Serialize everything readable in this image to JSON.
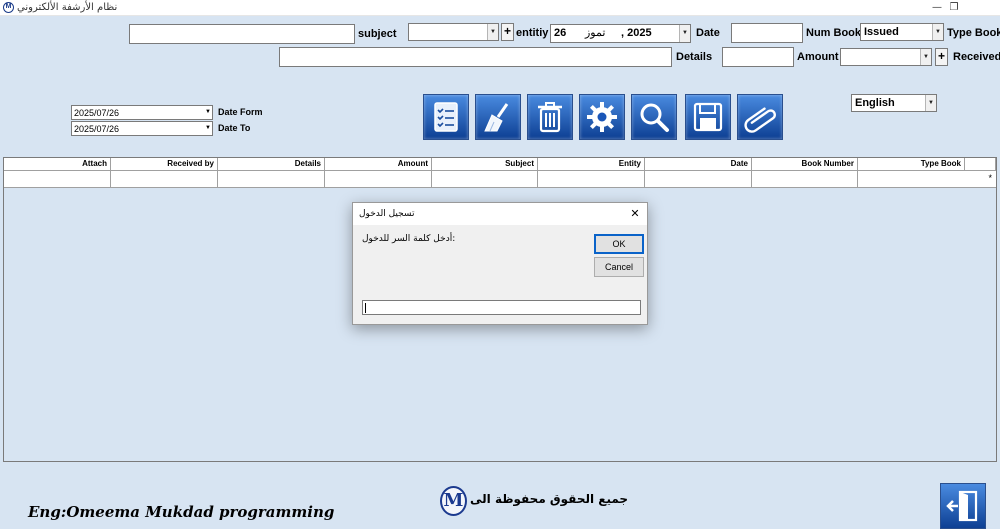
{
  "window": {
    "title": "نظام الأرشفة الألكتروني",
    "logo_letter": "M",
    "minimize": "—",
    "restore": "❐"
  },
  "form": {
    "subject_label": "subject",
    "subject_value": "",
    "entity_label": "entitiy",
    "entity_value": "",
    "date_label": "Date",
    "date_day": "26",
    "date_month": "تموز",
    "date_year": ", 2025",
    "num_book_label": "Num Book",
    "num_book_value": "",
    "type_book_label": "Type Book",
    "type_book_value": "Issued",
    "details_label": "Details",
    "details_value": "",
    "amount_label": "Amount",
    "amount_value": "",
    "received_label": "Received",
    "received_value": "",
    "plus": "+",
    "date_from_label": "Date Form",
    "date_from_value": "2025/07/26",
    "date_to_label": "Date To",
    "date_to_value": "2025/07/26",
    "language_value": "English"
  },
  "toolbar": {
    "icons": [
      "checklist-icon",
      "broom-icon",
      "trash-icon",
      "gear-icon",
      "search-icon",
      "save-icon",
      "paperclip-icon"
    ]
  },
  "grid": {
    "columns": [
      "Attach",
      "Received by",
      "Details",
      "Amount",
      "Subject",
      "Entity",
      "Date",
      "Book Number",
      "Type Book"
    ],
    "new_row_marker": "*"
  },
  "dialog": {
    "title": "تسجيل الدخول",
    "prompt": "أدخل كلمة السر للدخول:",
    "ok_label": "OK",
    "cancel_label": "Cancel",
    "close_glyph": "✕",
    "input_value": ""
  },
  "footer": {
    "signature": "Eng:Omeema Mukdad programming",
    "logo_letter": "M",
    "rights": "جميع الحقوق محفوظة الى"
  },
  "colors": {
    "background": "#d7e4f2",
    "toolbar_button": "#1a56b8",
    "dialog_ok_border": "#0a63c9"
  }
}
